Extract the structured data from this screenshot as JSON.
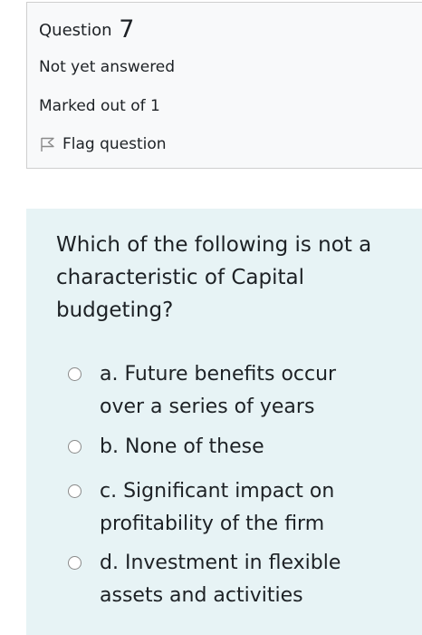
{
  "info": {
    "question_label": "Question",
    "question_number": "7",
    "state": "Not yet answered",
    "grade": "Marked out of 1",
    "flag_label": "Flag question"
  },
  "question": {
    "text": "Which of the following is not a characteristic of Capital budgeting?"
  },
  "answers": [
    {
      "prefix": "a.",
      "text": "Future benefits occur over a series of years"
    },
    {
      "prefix": "b.",
      "text": "None of these"
    },
    {
      "prefix": "c.",
      "text": "Significant impact on profitability of the firm"
    },
    {
      "prefix": "d.",
      "text": "Investment in flexible assets and activities"
    }
  ],
  "colors": {
    "info_background": "#f8f9fa",
    "formulation_background": "#e7f3f5",
    "border": "#cfcfcf",
    "text": "#1d2125"
  }
}
